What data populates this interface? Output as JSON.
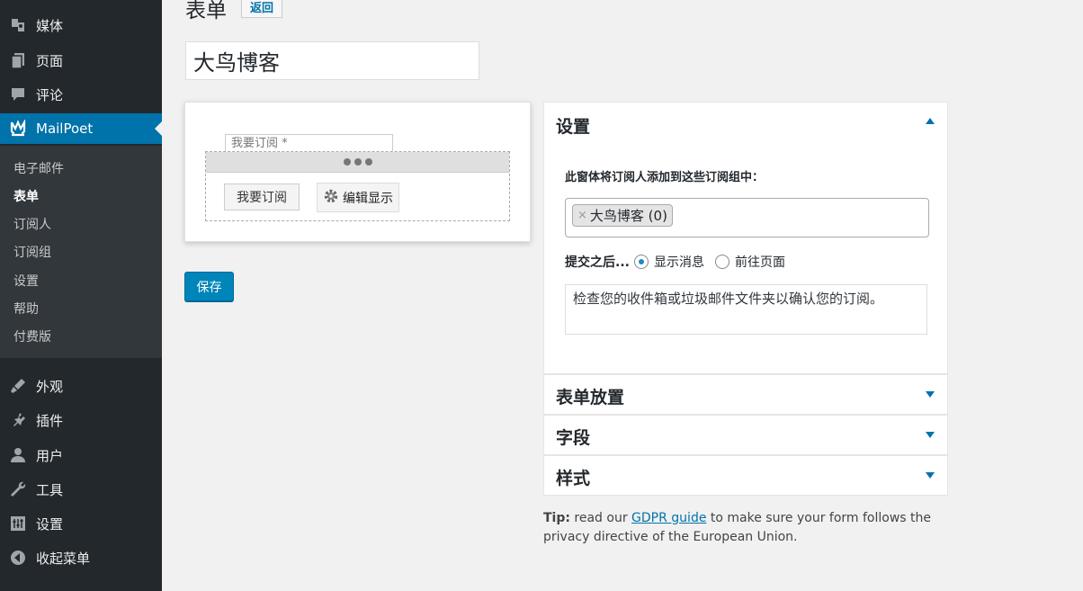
{
  "sidebar": {
    "top_items": [
      {
        "label": "媒体",
        "icon": "media-icon"
      },
      {
        "label": "页面",
        "icon": "pages-icon"
      },
      {
        "label": "评论",
        "icon": "comments-icon"
      },
      {
        "label": "MailPoet",
        "icon": "mailpoet-icon"
      }
    ],
    "submenu": [
      "电子邮件",
      "表单",
      "订阅人",
      "订阅组",
      "设置",
      "帮助",
      "付费版"
    ],
    "current_submenu": "表单",
    "bottom_items": [
      {
        "label": "外观",
        "icon": "appearance-icon"
      },
      {
        "label": "插件",
        "icon": "plugins-icon"
      },
      {
        "label": "用户",
        "icon": "users-icon"
      },
      {
        "label": "工具",
        "icon": "tools-icon"
      },
      {
        "label": "设置",
        "icon": "settings-icon"
      },
      {
        "label": "收起菜单",
        "icon": "collapse-icon"
      }
    ],
    "active_color": "#0073aa"
  },
  "header": {
    "title": "表单",
    "back_label": "返回"
  },
  "form_name": "大鸟博客",
  "preview": {
    "field_placeholder": "我要订阅 *",
    "submit_label": "我要订阅",
    "edit_display_label": "编辑显示"
  },
  "save_label": "保存",
  "settings_panel": {
    "title": "设置",
    "list_label": "此窗体将订阅人添加到这些订阅组中：",
    "chip_remove": "×",
    "chip_label": "大鸟博客 (0)",
    "after_submit_label": "提交之后...",
    "option_show_message": "显示消息",
    "option_go_page": "前往页面",
    "message_text": "检查您的收件箱或垃圾邮件文件夹以确认您的订阅。"
  },
  "panels": [
    {
      "title": "表单放置"
    },
    {
      "title": "字段"
    },
    {
      "title": "样式"
    }
  ],
  "tip": {
    "prefix": "Tip:",
    "text1": " read our ",
    "link": "GDPR guide",
    "text2": " to make sure your form follows the privacy directive of the European Union."
  }
}
